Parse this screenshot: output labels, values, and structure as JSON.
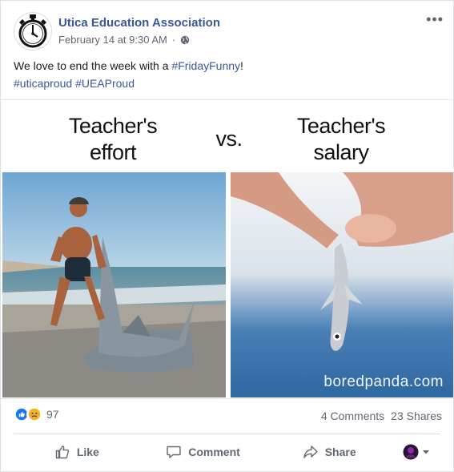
{
  "post": {
    "page_name": "Utica Education Association",
    "timestamp": "February 14 at 9:30 AM",
    "audience_separator": "·",
    "text_before": "We love to end the week with a ",
    "hashtag_main": "#FridayFunny",
    "text_after": "!",
    "hashtag_line": [
      "#uticaproud",
      "#UEAProud"
    ]
  },
  "image": {
    "left_caption_line1": "Teacher's",
    "left_caption_line2": "effort",
    "vs": "vs.",
    "right_caption_line1": "Teacher's",
    "right_caption_line2": "salary",
    "watermark": "boredpanda.com"
  },
  "stats": {
    "reactions": [
      "like",
      "sad"
    ],
    "reaction_count": "97",
    "comments": "4 Comments",
    "shares": "23 Shares"
  },
  "actions": {
    "like": "Like",
    "comment": "Comment",
    "share": "Share"
  },
  "colors": {
    "link": "#385898",
    "like_blue": "#1877f2",
    "sad_yellow": "#f7b125"
  }
}
